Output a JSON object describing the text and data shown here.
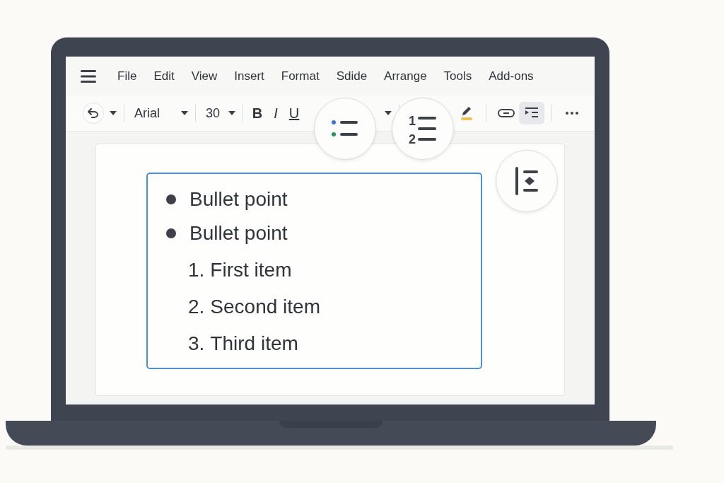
{
  "menu": {
    "items": [
      "File",
      "Edit",
      "View",
      "Insert",
      "Format",
      "Sdide",
      "Arrange",
      "Tools",
      "Add-ons"
    ]
  },
  "toolbar": {
    "font": "Arial",
    "size": "30",
    "buttons": [
      {
        "kind": "undo",
        "selected": false
      },
      {
        "kind": "font"
      },
      {
        "kind": "size"
      },
      {
        "kind": "bold",
        "label": "B",
        "selected": false
      },
      {
        "kind": "italic",
        "label": "I",
        "selected": false
      },
      {
        "kind": "underline",
        "label": "U",
        "selected": false
      },
      {
        "kind": "dropdown"
      },
      {
        "kind": "highlight",
        "selected": false
      },
      {
        "kind": "link",
        "selected": false
      },
      {
        "kind": "indent",
        "selected": true
      },
      {
        "kind": "more",
        "selected": false
      }
    ]
  },
  "callouts": [
    {
      "kind": "bulleted"
    },
    {
      "kind": "numbered",
      "numbers": [
        "1",
        "2"
      ]
    },
    {
      "kind": "indent"
    }
  ],
  "text_box": {
    "items": [
      {
        "kind": "bullet",
        "text": "Bullet point"
      },
      {
        "kind": "bullet",
        "text": "Bullet point"
      },
      {
        "kind": "numbered",
        "marker": "1.",
        "text": "First item"
      },
      {
        "kind": "numbered",
        "marker": "2.",
        "text": "Second item"
      },
      {
        "kind": "numbered",
        "marker": "3.",
        "text": "Third item"
      }
    ]
  }
}
